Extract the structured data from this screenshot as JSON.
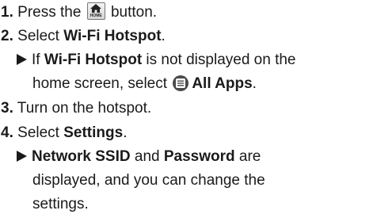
{
  "steps": [
    {
      "num": "1.",
      "pre": "Press the",
      "post": "button.",
      "icon": "home-button-icon",
      "icon_caption": "HOME"
    },
    {
      "num": "2.",
      "pre": "Select",
      "bold": "Wi-Fi Hotspot",
      "post": "."
    },
    {
      "num": "3.",
      "text": "Turn on the hotspot."
    },
    {
      "num": "4.",
      "pre": "Select",
      "bold": "Settings",
      "post": "."
    }
  ],
  "note1": {
    "pre": "If",
    "bold": "Wi-Fi Hotspot",
    "post": "is not displayed on the",
    "line2_pre": "home screen, select",
    "icon": "all-apps-icon",
    "line2_bold": "All Apps",
    "line2_post": "."
  },
  "note2": {
    "bold1": "Network SSID",
    "mid": "and",
    "bold2": "Password",
    "post": "are",
    "line2": "displayed, and you can change the",
    "line3": "settings."
  }
}
